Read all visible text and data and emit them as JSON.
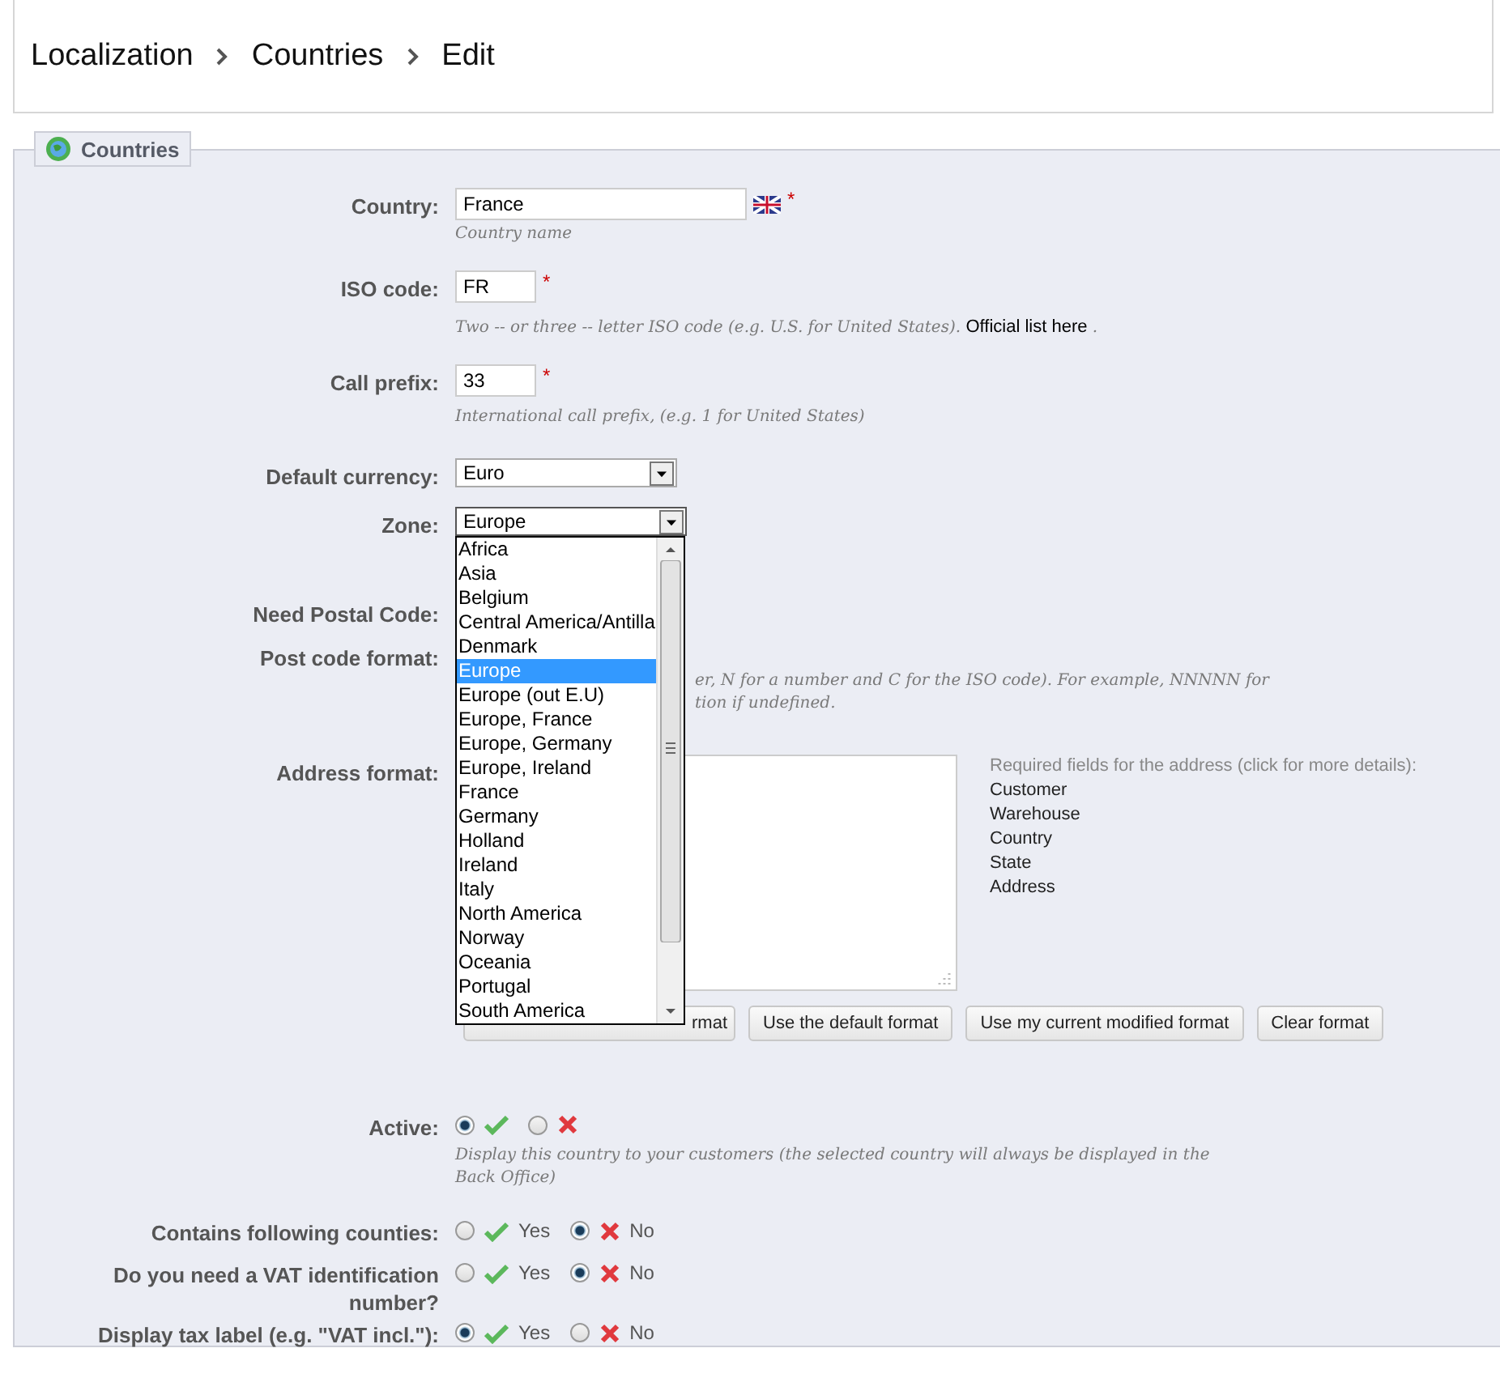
{
  "breadcrumb": [
    "Localization",
    "Countries",
    "Edit"
  ],
  "panel": {
    "title": "Countries"
  },
  "country": {
    "label": "Country:",
    "value": "France",
    "required_mark": "*",
    "hint": "Country name"
  },
  "iso_code": {
    "label": "ISO code:",
    "value": "FR",
    "required_mark": "*",
    "hint": "Two -- or three -- letter ISO code (e.g. U.S. for United States).",
    "link": "Official list here",
    "hint_end": "."
  },
  "call_prefix": {
    "label": "Call prefix:",
    "value": "33",
    "required_mark": "*",
    "hint": "International call prefix, (e.g. 1 for United States)"
  },
  "currency": {
    "label": "Default currency:",
    "value": "Euro"
  },
  "zone": {
    "label": "Zone:",
    "value": "Europe",
    "expanded": true,
    "options": [
      {
        "label": "Africa",
        "selected": false
      },
      {
        "label": "Asia",
        "selected": false
      },
      {
        "label": "Belgium",
        "selected": false
      },
      {
        "label": "Central America/Antilla",
        "selected": false
      },
      {
        "label": "Denmark",
        "selected": false
      },
      {
        "label": "Europe",
        "selected": true
      },
      {
        "label": "Europe (out E.U)",
        "selected": false
      },
      {
        "label": "Europe, France",
        "selected": false
      },
      {
        "label": "Europe, Germany",
        "selected": false
      },
      {
        "label": "Europe, Ireland",
        "selected": false
      },
      {
        "label": "France",
        "selected": false
      },
      {
        "label": "Germany",
        "selected": false
      },
      {
        "label": "Holland",
        "selected": false
      },
      {
        "label": "Ireland",
        "selected": false
      },
      {
        "label": "Italy",
        "selected": false
      },
      {
        "label": "North America",
        "selected": false
      },
      {
        "label": "Norway",
        "selected": false
      },
      {
        "label": "Oceania",
        "selected": false
      },
      {
        "label": "Portugal",
        "selected": false
      },
      {
        "label": "South America",
        "selected": false
      }
    ]
  },
  "need_postal_code": {
    "label": "Need Postal Code:"
  },
  "post_code_format": {
    "label": "Post code format:",
    "hint_lines": [
      "er, N for a number and C for the ISO code). For example, NNNNN for",
      "tion if undefined."
    ]
  },
  "address_format": {
    "label": "Address format:",
    "required_title": "Required fields for the address (click for more details):",
    "required_fields": [
      "Customer",
      "Warehouse",
      "Country",
      "State",
      "Address"
    ],
    "buttons": [
      "rmat",
      "Use the default format",
      "Use my current modified format",
      "Clear format"
    ]
  },
  "toggles": [
    {
      "label": "Active:",
      "hint": "Display this country to your customers (the selected country will always be displayed in the Back Office)",
      "options": [
        {
          "kind": "yes",
          "selected": true
        },
        {
          "kind": "no",
          "selected": false
        }
      ]
    },
    {
      "label": "Contains following counties:",
      "options": [
        {
          "kind": "yes",
          "text": "Yes",
          "selected": false
        },
        {
          "kind": "no",
          "text": "No",
          "selected": true
        }
      ]
    },
    {
      "label": "Do you need a VAT identification number?",
      "options": [
        {
          "kind": "yes",
          "text": "Yes",
          "selected": false
        },
        {
          "kind": "no",
          "text": "No",
          "selected": true
        }
      ]
    },
    {
      "label": "Display tax label (e.g. \"VAT incl.\"):",
      "options": [
        {
          "kind": "yes",
          "text": "Yes",
          "selected": true
        },
        {
          "kind": "no",
          "text": "No",
          "selected": false
        }
      ]
    }
  ]
}
